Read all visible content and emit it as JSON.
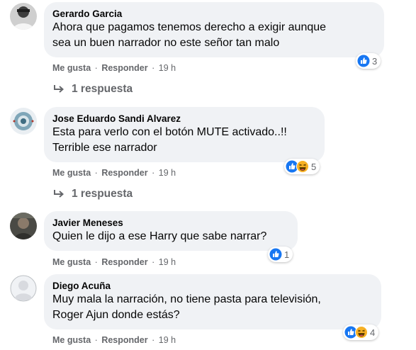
{
  "comments": [
    {
      "author": "Gerardo Garcia",
      "text": "Ahora que pagamos tenemos derecho a exigir aunque\nsea un buen narrador no este señor tan malo",
      "like_label": "Me gusta",
      "reply_label": "Responder",
      "time": "19 h",
      "reactions": [
        "like-icon"
      ],
      "reaction_count": "3",
      "replies_label": "1 respuesta"
    },
    {
      "author": "Jose Eduardo Sandi Alvarez",
      "text": "Esta para verlo con el botón MUTE activado..!!\nTerrible ese narrador",
      "like_label": "Me gusta",
      "reply_label": "Responder",
      "time": "19 h",
      "reactions": [
        "like-icon",
        "haha-icon"
      ],
      "reaction_count": "5",
      "replies_label": "1 respuesta"
    },
    {
      "author": "Javier Meneses",
      "text": "Quien le dijo a ese Harry que sabe narrar?",
      "like_label": "Me gusta",
      "reply_label": "Responder",
      "time": "19 h",
      "reactions": [
        "like-icon"
      ],
      "reaction_count": "1"
    },
    {
      "author": "Diego Acuña",
      "text": "Muy mala la narración, no tiene pasta para televisión,\nRoger Ajun donde estás?",
      "like_label": "Me gusta",
      "reply_label": "Responder",
      "time": "19 h",
      "reactions": [
        "like-icon",
        "haha-icon"
      ],
      "reaction_count": "4"
    }
  ],
  "separator": "·",
  "colors": {
    "bubble": "#f0f2f5",
    "like_blue": "#1877f2",
    "haha_yellow": "#f7b125",
    "meta_gray": "#65676b"
  }
}
